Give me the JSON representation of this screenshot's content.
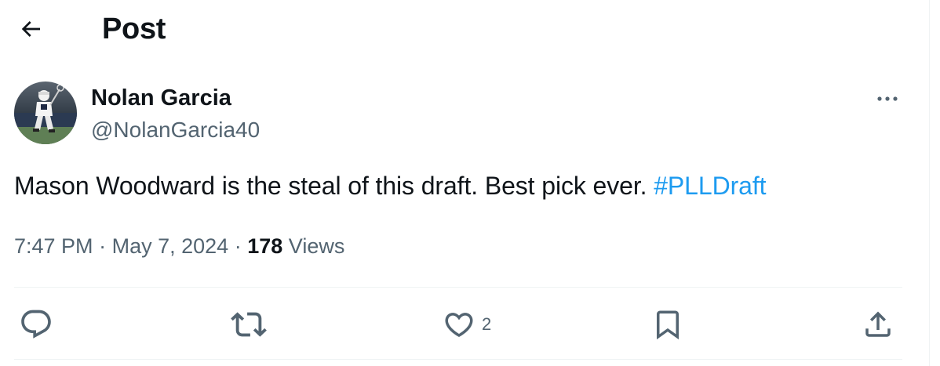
{
  "header": {
    "title": "Post",
    "back_icon": "arrow-left-icon"
  },
  "author": {
    "display_name": "Nolan Garcia",
    "handle": "@NolanGarcia40",
    "avatar": "lacrosse-player-avatar"
  },
  "tweet": {
    "text": "Mason Woodward is the steal of this draft. Best pick ever. ",
    "hashtag": "#PLLDraft"
  },
  "meta": {
    "time": "7:47 PM",
    "separator": "·",
    "date": "May 7, 2024",
    "views_count": "178",
    "views_label": "Views"
  },
  "actions": {
    "reply_icon": "reply-icon",
    "repost_icon": "repost-icon",
    "like_icon": "heart-icon",
    "like_count": "2",
    "bookmark_icon": "bookmark-icon",
    "share_icon": "share-icon"
  },
  "colors": {
    "text": "#0f1419",
    "secondary": "#536471",
    "accent": "#1d9bf0",
    "border": "#eff3f4"
  }
}
